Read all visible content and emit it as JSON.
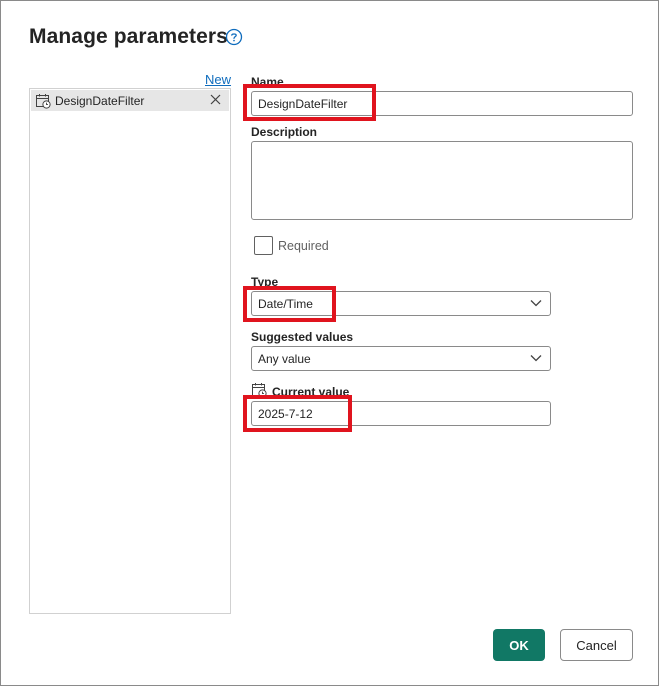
{
  "dialog": {
    "title": "Manage parameters",
    "help_icon": "question-circle-icon",
    "new_link": "New"
  },
  "parameters": [
    {
      "label": "DesignDateFilter",
      "icon": "calendar-clock-icon",
      "selected": true
    }
  ],
  "form": {
    "name_label": "Name",
    "name_value": "DesignDateFilter",
    "description_label": "Description",
    "description_value": "",
    "required_label": "Required",
    "required_checked": false,
    "type_label": "Type",
    "type_value": "Date/Time",
    "suggested_label": "Suggested values",
    "suggested_value": "Any value",
    "current_label": "Current value",
    "current_value": "2025-7-12"
  },
  "buttons": {
    "ok": "OK",
    "cancel": "Cancel"
  },
  "colors": {
    "accent": "#117865",
    "link": "#0f6cbd",
    "highlight": "#e0141e"
  }
}
